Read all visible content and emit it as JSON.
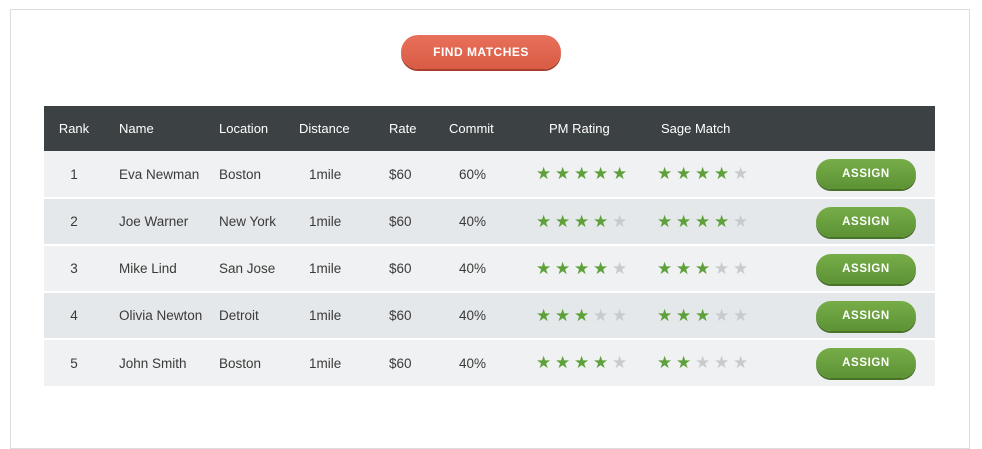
{
  "find_button": "FIND MATCHES",
  "columns": {
    "rank": "Rank",
    "name": "Name",
    "location": "Location",
    "distance": "Distance",
    "rate": "Rate",
    "commit": "Commit",
    "pm_rating": "PM Rating",
    "sage_match": "Sage Match"
  },
  "rating_max": 5,
  "colors": {
    "star_on": "#5ea03a",
    "star_off": "#c8cbcd",
    "assign": "#6aa03e",
    "find": "#e0654f",
    "header": "#3c4144"
  },
  "rows": [
    {
      "rank": "1",
      "name": "Eva Newman",
      "location": "Boston",
      "distance": "1mile",
      "rate": "$60",
      "commit": "60%",
      "pm_rating": 5,
      "sage_match": 4,
      "action": "ASSIGN"
    },
    {
      "rank": "2",
      "name": "Joe Warner",
      "location": "New York",
      "distance": "1mile",
      "rate": "$60",
      "commit": "40%",
      "pm_rating": 4,
      "sage_match": 4,
      "action": "ASSIGN"
    },
    {
      "rank": "3",
      "name": "Mike Lind",
      "location": "San Jose",
      "distance": "1mile",
      "rate": "$60",
      "commit": "40%",
      "pm_rating": 4,
      "sage_match": 3,
      "action": "ASSIGN"
    },
    {
      "rank": "4",
      "name": "Olivia Newton",
      "location": "Detroit",
      "distance": "1mile",
      "rate": "$60",
      "commit": "40%",
      "pm_rating": 3,
      "sage_match": 3,
      "action": "ASSIGN"
    },
    {
      "rank": "5",
      "name": "John Smith",
      "location": "Boston",
      "distance": "1mile",
      "rate": "$60",
      "commit": "40%",
      "pm_rating": 4,
      "sage_match": 2,
      "action": "ASSIGN"
    }
  ]
}
